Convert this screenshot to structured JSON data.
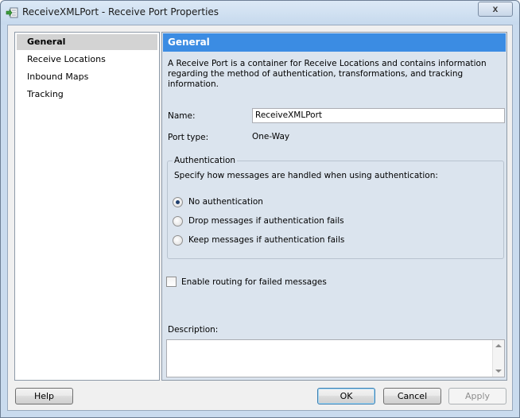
{
  "window": {
    "title": "ReceiveXMLPort - Receive Port Properties",
    "close_label": "x"
  },
  "nav": {
    "items": [
      {
        "label": "General",
        "selected": true
      },
      {
        "label": "Receive Locations",
        "selected": false
      },
      {
        "label": "Inbound Maps",
        "selected": false
      },
      {
        "label": "Tracking",
        "selected": false
      }
    ]
  },
  "general": {
    "header": "General",
    "description": "A Receive Port is a container for Receive Locations and contains information regarding the method of authentication, transformations, and tracking information.",
    "name_label": "Name:",
    "name_value": "ReceiveXMLPort",
    "port_type_label": "Port type:",
    "port_type_value": "One-Way",
    "authentication": {
      "legend": "Authentication",
      "instruction": "Specify how messages are handled when using authentication:",
      "options": [
        {
          "label": "No authentication",
          "checked": true
        },
        {
          "label": "Drop messages if authentication fails",
          "checked": false
        },
        {
          "label": "Keep messages if authentication fails",
          "checked": false
        }
      ]
    },
    "routing_checkbox_label": "Enable routing for failed messages",
    "routing_checked": false,
    "description_label": "Description:",
    "description_value": ""
  },
  "buttons": {
    "help": "Help",
    "ok": "OK",
    "cancel": "Cancel",
    "apply": "Apply"
  },
  "colors": {
    "header_blue": "#3b8ce3",
    "panel_bg": "#dbe4ee",
    "nav_selected": "#d3d3d3"
  }
}
